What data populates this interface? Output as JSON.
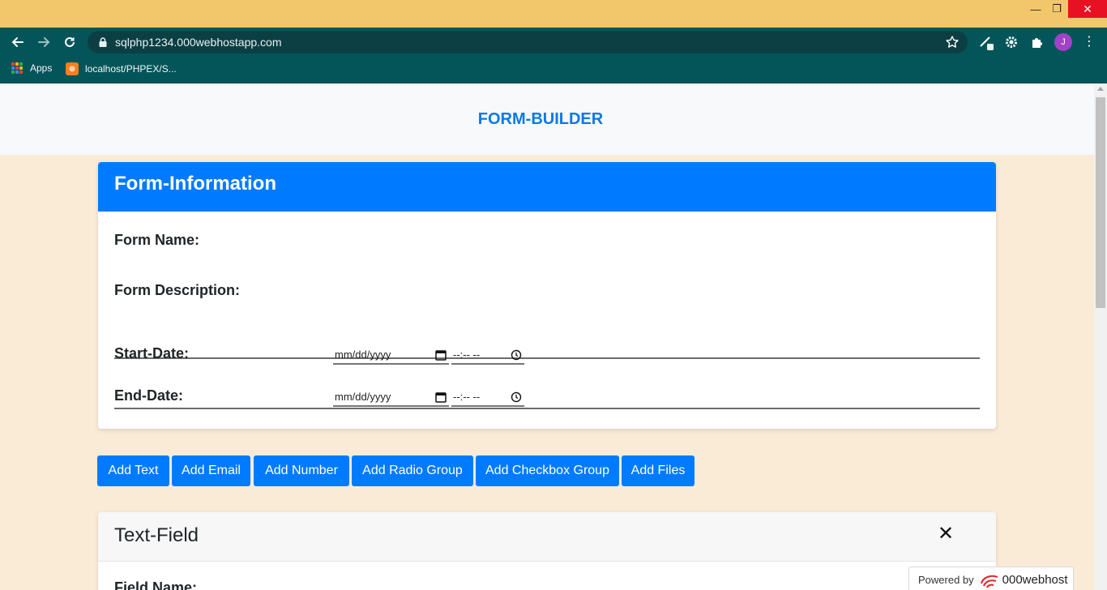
{
  "browser": {
    "url": "sqlphp1234.000webhostapp.com",
    "avatar_initial": "J",
    "bookmarks": [
      {
        "label": "Apps"
      },
      {
        "label": "localhost/PHPEX/S..."
      }
    ]
  },
  "site": {
    "title": "FORM-BUILDER"
  },
  "form_info": {
    "heading": "Form-Information",
    "form_name_label": "Form Name:",
    "form_name_value": "",
    "form_description_label": "Form Description:",
    "form_description_value": "",
    "start_date_label": "Start-Date:",
    "end_date_label": "End-Date:",
    "date_placeholder": "mm/dd/yyyy",
    "time_placeholder": "--:-- --"
  },
  "buttons": {
    "add_text": "Add Text",
    "add_email": "Add Email",
    "add_number": "Add Number",
    "add_radio_group": "Add Radio Group",
    "add_checkbox_group": "Add Checkbox Group",
    "add_files": "Add Files"
  },
  "text_field_card": {
    "heading": "Text-Field",
    "close": "✕",
    "field_name_label": "Field Name:"
  },
  "powered": {
    "prefix": "Powered by",
    "brand": "000webhost"
  },
  "colors": {
    "primary": "#007bff",
    "title_bar": "#f2c76b",
    "toolbar": "#04555a",
    "page_bg": "#faebd7"
  }
}
